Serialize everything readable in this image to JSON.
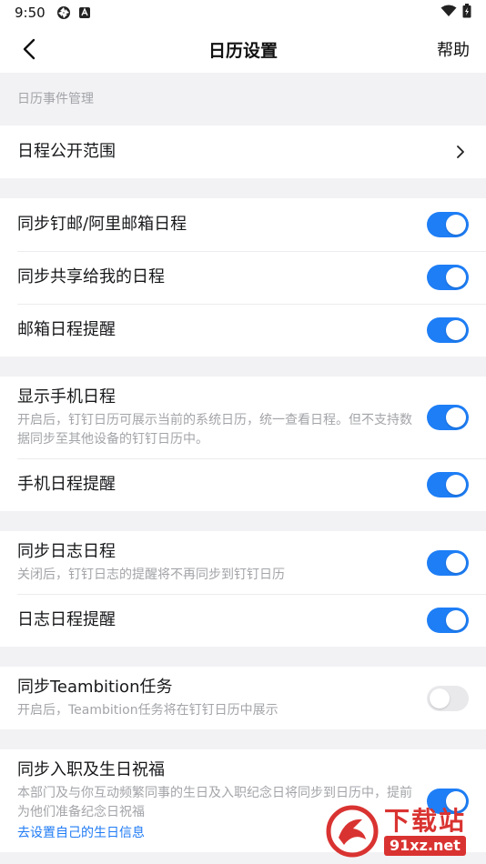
{
  "status_bar": {
    "time": "9:50"
  },
  "nav": {
    "title": "日历设置",
    "help": "帮助"
  },
  "section_header": "日历事件管理",
  "groups": [
    {
      "rows": [
        {
          "title": "日程公开范围",
          "type": "chevron"
        }
      ]
    },
    {
      "rows": [
        {
          "title": "同步钉邮/阿里邮箱日程",
          "toggle": true
        },
        {
          "title": "同步共享给我的日程",
          "toggle": true
        },
        {
          "title": "邮箱日程提醒",
          "toggle": true
        }
      ]
    },
    {
      "rows": [
        {
          "title": "显示手机日程",
          "desc": "开启后，钉钉日历可展示当前的系统日历，统一查看日程。但不支持数据同步至其他设备的钉钉日历中。",
          "toggle": true
        },
        {
          "title": "手机日程提醒",
          "toggle": true
        }
      ]
    },
    {
      "rows": [
        {
          "title": "同步日志日程",
          "desc": "关闭后，钉钉日志的提醒将不再同步到钉钉日历",
          "toggle": true
        },
        {
          "title": "日志日程提醒",
          "toggle": true
        }
      ]
    },
    {
      "rows": [
        {
          "title": "同步Teambition任务",
          "desc": "开启后，Teambition任务将在钉钉日历中展示",
          "toggle": false
        }
      ]
    },
    {
      "rows": [
        {
          "title": "同步入职及生日祝福",
          "desc": "本部门及与你互动频繁同事的生日及入职纪念日将同步到日历中，提前为他们准备纪念日祝福",
          "link": "去设置自己的生日信息",
          "toggle": true
        }
      ]
    }
  ],
  "watermark": {
    "line1": "下载站",
    "line2": "91xz.net"
  },
  "colors": {
    "accent": "#1e7ef6",
    "link": "#1f7bf5",
    "toggle_off": "#e9e9ec",
    "watermark": "#d93331"
  }
}
